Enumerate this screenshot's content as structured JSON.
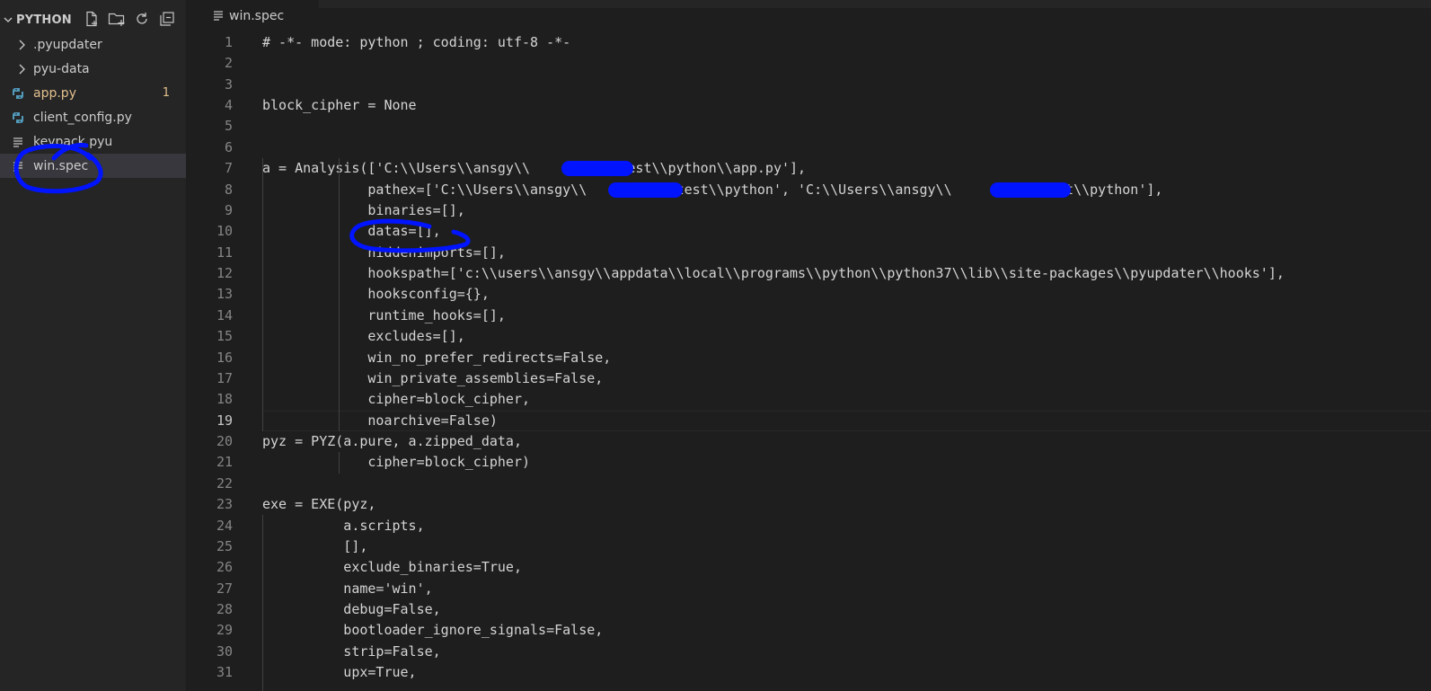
{
  "explorer": {
    "title": "PYTHON",
    "actions": [
      {
        "name": "new-file-icon"
      },
      {
        "name": "new-folder-icon"
      },
      {
        "name": "refresh-icon"
      },
      {
        "name": "collapse-all-icon"
      }
    ],
    "items": [
      {
        "label": ".pyupdater",
        "type": "folder",
        "icon": "chevron-right-icon"
      },
      {
        "label": "pyu-data",
        "type": "folder",
        "icon": "chevron-right-icon"
      },
      {
        "label": "app.py",
        "type": "python",
        "icon": "python-icon",
        "badge": "1",
        "modified": true
      },
      {
        "label": "client_config.py",
        "type": "python",
        "icon": "python-icon"
      },
      {
        "label": "keypack.pyu",
        "type": "text",
        "icon": "lines-icon"
      },
      {
        "label": "win.spec",
        "type": "text",
        "icon": "lines-icon",
        "active": true
      }
    ]
  },
  "tab": {
    "label": "win.spec",
    "icon": "lines-icon"
  },
  "editor": {
    "current_line": 19,
    "lines": [
      {
        "n": "1",
        "text": "# -*- mode: python ; coding: utf-8 -*-"
      },
      {
        "n": "2",
        "text": ""
      },
      {
        "n": "3",
        "text": ""
      },
      {
        "n": "4",
        "text": "block_cipher = None"
      },
      {
        "n": "5",
        "text": ""
      },
      {
        "n": "6",
        "text": ""
      },
      {
        "n": "7",
        "text": "a = Analysis(['C:\\\\Users\\\\ansgy\\\\         \\\\test\\\\python\\\\app.py'],"
      },
      {
        "n": "8",
        "text": "             pathex=['C:\\\\Users\\\\ansgy\\\\         \\\\test\\\\python', 'C:\\\\Users\\\\ansgy\\\\         \\\\test\\\\python'],"
      },
      {
        "n": "9",
        "text": "             binaries=[],"
      },
      {
        "n": "10",
        "text": "             datas=[],"
      },
      {
        "n": "11",
        "text": "             hiddenimports=[],"
      },
      {
        "n": "12",
        "text": "             hookspath=['c:\\\\users\\\\ansgy\\\\appdata\\\\local\\\\programs\\\\python\\\\python37\\\\lib\\\\site-packages\\\\pyupdater\\\\hooks'],"
      },
      {
        "n": "13",
        "text": "             hooksconfig={},"
      },
      {
        "n": "14",
        "text": "             runtime_hooks=[],"
      },
      {
        "n": "15",
        "text": "             excludes=[],"
      },
      {
        "n": "16",
        "text": "             win_no_prefer_redirects=False,"
      },
      {
        "n": "17",
        "text": "             win_private_assemblies=False,"
      },
      {
        "n": "18",
        "text": "             cipher=block_cipher,"
      },
      {
        "n": "19",
        "text": "             noarchive=False)"
      },
      {
        "n": "20",
        "text": "pyz = PYZ(a.pure, a.zipped_data,"
      },
      {
        "n": "21",
        "text": "             cipher=block_cipher)"
      },
      {
        "n": "22",
        "text": ""
      },
      {
        "n": "23",
        "text": "exe = EXE(pyz,"
      },
      {
        "n": "24",
        "text": "          a.scripts,"
      },
      {
        "n": "25",
        "text": "          [],"
      },
      {
        "n": "26",
        "text": "          exclude_binaries=True,"
      },
      {
        "n": "27",
        "text": "          name='win',"
      },
      {
        "n": "28",
        "text": "          debug=False,"
      },
      {
        "n": "29",
        "text": "          bootloader_ignore_signals=False,"
      },
      {
        "n": "30",
        "text": "          strip=False,"
      },
      {
        "n": "31",
        "text": "          upx=True,"
      }
    ]
  },
  "colors": {
    "annotation": "#0014ff",
    "modified": "#e2c08d",
    "python_icon": "#519aba"
  }
}
